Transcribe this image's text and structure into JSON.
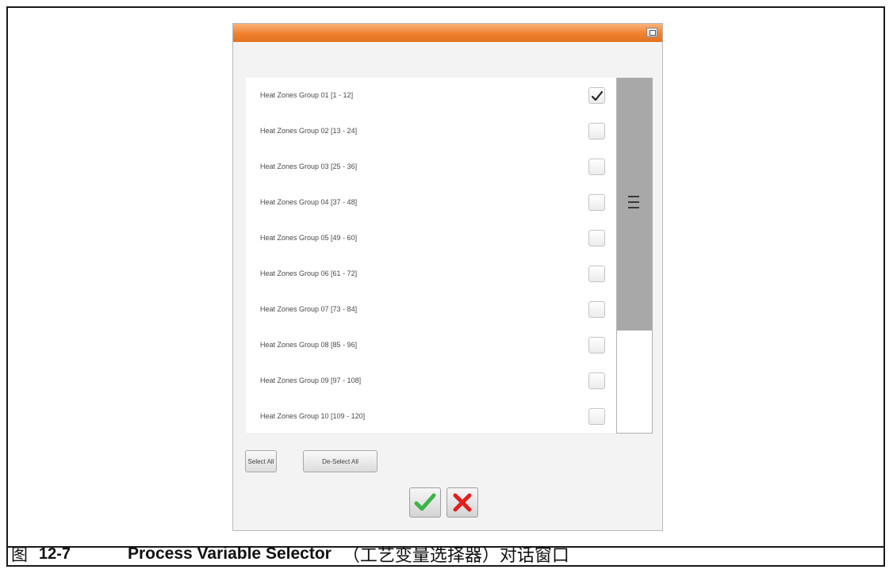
{
  "dialog": {
    "title": "",
    "groups_label": "",
    "items": [
      {
        "label": "Heat Zones Group 01 [1 - 12]",
        "checked": true
      },
      {
        "label": "Heat Zones Group 02 [13 - 24]",
        "checked": false
      },
      {
        "label": "Heat Zones Group 03 [25 - 36]",
        "checked": false
      },
      {
        "label": "Heat Zones Group 04 [37 - 48]",
        "checked": false
      },
      {
        "label": "Heat Zones Group 05 [49 - 60]",
        "checked": false
      },
      {
        "label": "Heat Zones Group 06 [61 - 72]",
        "checked": false
      },
      {
        "label": "Heat Zones Group 07 [73 - 84]",
        "checked": false
      },
      {
        "label": "Heat Zones Group 08 [85 - 96]",
        "checked": false
      },
      {
        "label": "Heat Zones Group 09 [97 - 108]",
        "checked": false
      },
      {
        "label": "Heat Zones Group 10 [109 - 120]",
        "checked": false
      }
    ],
    "select_all_label": "Select All",
    "deselect_all_label": "De-Select All",
    "ok_icon": "green-checkmark-icon",
    "cancel_icon": "red-x-icon",
    "titlebar_color": "#ef8130",
    "ok_color": "#3bb54a",
    "cancel_color": "#e0201c"
  },
  "caption": {
    "label": "图",
    "number": "12-7",
    "title": "Process Variable Selector",
    "title_cn": "（工艺变量选择器）对话窗口"
  }
}
